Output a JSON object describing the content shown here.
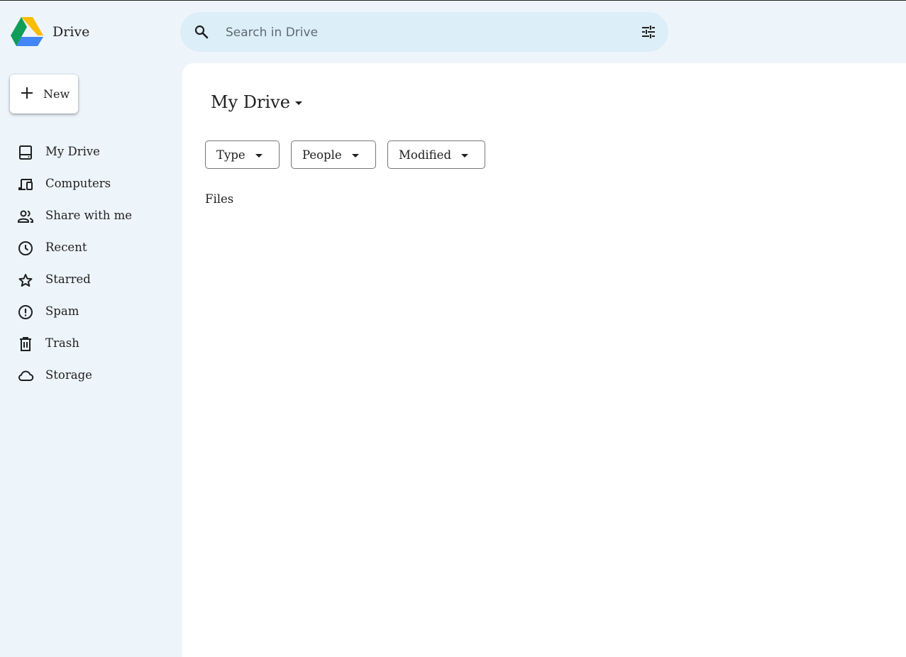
{
  "app": {
    "title": "Drive",
    "logo_icon": "google-drive-logo",
    "logo_colors": [
      "#0f9d58",
      "#fbbc04",
      "#4285f4"
    ]
  },
  "search": {
    "placeholder": "Search in Drive",
    "value": "",
    "icon": "search-icon",
    "options_icon": "tune-icon"
  },
  "new_button": {
    "label": "New",
    "icon": "plus-icon"
  },
  "sidebar": {
    "items": [
      {
        "label": "My Drive",
        "icon": "my-drive-icon"
      },
      {
        "label": "Computers",
        "icon": "computers-icon"
      },
      {
        "label": "Share with me",
        "icon": "people-icon"
      },
      {
        "label": "Recent",
        "icon": "clock-icon"
      },
      {
        "label": "Starred",
        "icon": "star-icon"
      },
      {
        "label": "Spam",
        "icon": "spam-icon"
      },
      {
        "label": "Trash",
        "icon": "trash-icon"
      },
      {
        "label": "Storage",
        "icon": "cloud-icon"
      }
    ]
  },
  "main": {
    "title": "My Drive",
    "filters": [
      {
        "label": "Type"
      },
      {
        "label": "People"
      },
      {
        "label": "Modified"
      }
    ],
    "files_heading": "Files"
  },
  "colors": {
    "background": "#edf5fb",
    "search_background": "#dceef8",
    "content_background": "#ffffff",
    "text": "#1f1f1f"
  }
}
